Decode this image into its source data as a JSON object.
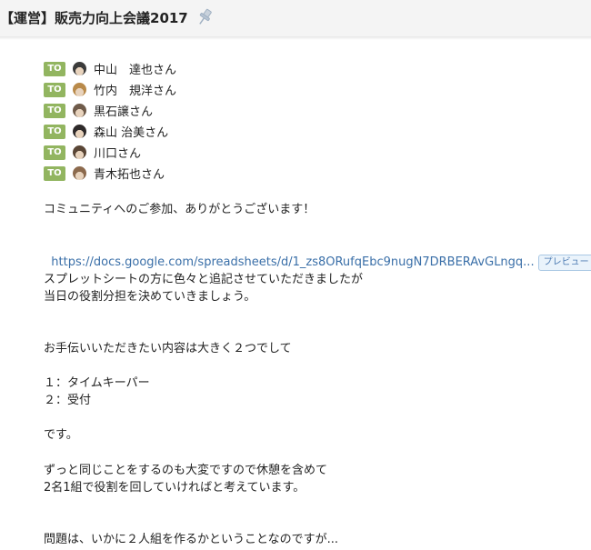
{
  "header": {
    "title": "【運営】販売力向上会議2017",
    "pin_icon": "pin-icon"
  },
  "mentions": [
    {
      "badge": "TO",
      "name": "中山　達也さん",
      "avatar_color": "#3b3b3b"
    },
    {
      "badge": "TO",
      "name": "竹内　規洋さん",
      "avatar_color": "#b98a4a"
    },
    {
      "badge": "TO",
      "name": "黒石譲さん",
      "avatar_color": "#6f5b4a"
    },
    {
      "badge": "TO",
      "name": "森山 治美さん",
      "avatar_color": "#2e2a2a"
    },
    {
      "badge": "TO",
      "name": "川口さん",
      "avatar_color": "#5a4636"
    },
    {
      "badge": "TO",
      "name": "青木拓也さん",
      "avatar_color": "#8c6a4d"
    }
  ],
  "message": {
    "greeting": "コミュニティへのご参加、ありがとうございます！",
    "link_text": "https://docs.google.com/spreadsheets/d/1_zs8ORufqEbc9nugN7DRBERAvGLngq...",
    "preview_label": "プレビュー",
    "para1_line1": "スプレットシートの方に色々と追記させていただきましたが",
    "para1_line2": "当日の役割分担を決めていきましょう。",
    "para2": "お手伝いいただきたい内容は大きく２つでして",
    "item1": "１：タイムキーパー",
    "item2": "２：受付",
    "para3": "です。",
    "para4_line1": "ずっと同じことをするのも大変ですので休憩を含めて",
    "para4_line2": "2名1組で役割を回していければと考えています。",
    "para5": "問題は、いかに２人組を作るかということなのですが..."
  },
  "colors": {
    "to_badge": "#92b560",
    "link": "#3a6fa8"
  }
}
